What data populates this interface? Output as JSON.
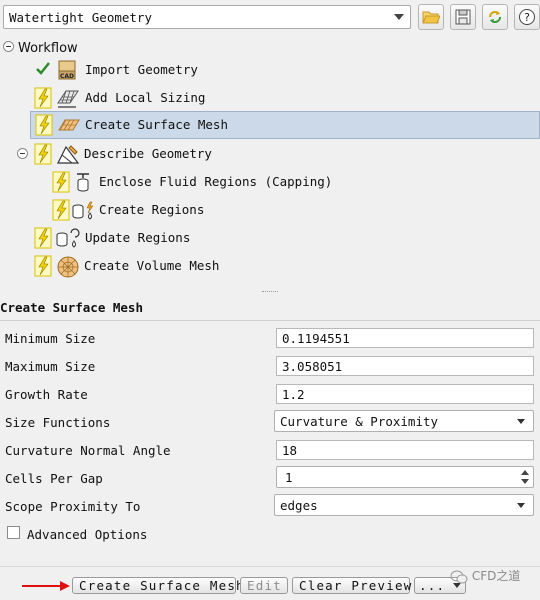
{
  "workflow_selector": {
    "value": "Watertight Geometry"
  },
  "toolbar_icons": [
    "folder-open-icon",
    "save-icon",
    "refresh-icon",
    "help-icon"
  ],
  "toolbar": {
    "help_label": "?"
  },
  "tree": {
    "root_label": "Workflow",
    "tasks": [
      {
        "label": "Import Geometry",
        "status": "complete"
      },
      {
        "label": "Add Local Sizing",
        "status": "pending"
      },
      {
        "label": "Create Surface Mesh",
        "status": "pending",
        "selected": true
      },
      {
        "label": "Describe Geometry",
        "status": "pending"
      },
      {
        "label": "Enclose Fluid Regions (Capping)",
        "status": "pending"
      },
      {
        "label": "Create Regions",
        "status": "pending"
      },
      {
        "label": "Update Regions",
        "status": "pending"
      },
      {
        "label": "Create Volume Mesh",
        "status": "pending"
      }
    ]
  },
  "panel": {
    "title": "Create Surface Mesh",
    "fields": {
      "min_size": {
        "label": "Minimum Size",
        "value": "0.1194551"
      },
      "max_size": {
        "label": "Maximum Size",
        "value": "3.058051"
      },
      "growth_rate": {
        "label": "Growth Rate",
        "value": "1.2"
      },
      "size_functions": {
        "label": "Size Functions",
        "value": "Curvature & Proximity"
      },
      "curv_angle": {
        "label": "Curvature Normal Angle",
        "value": "18"
      },
      "cells_per_gap": {
        "label": "Cells Per Gap",
        "value": "1"
      },
      "scope_proximity": {
        "label": "Scope Proximity To",
        "value": "edges"
      }
    },
    "advanced_options": {
      "label": "Advanced Options",
      "checked": false
    }
  },
  "buttons": {
    "create": "Create Surface Mesh",
    "edit": "Edit",
    "clear_preview": "Clear Preview",
    "more": "..."
  },
  "watermark": "CFD之道",
  "colors": {
    "selected_row": "#ccd9e8",
    "pending_bolt": "#f2d200",
    "check": "#2e8b2e"
  }
}
